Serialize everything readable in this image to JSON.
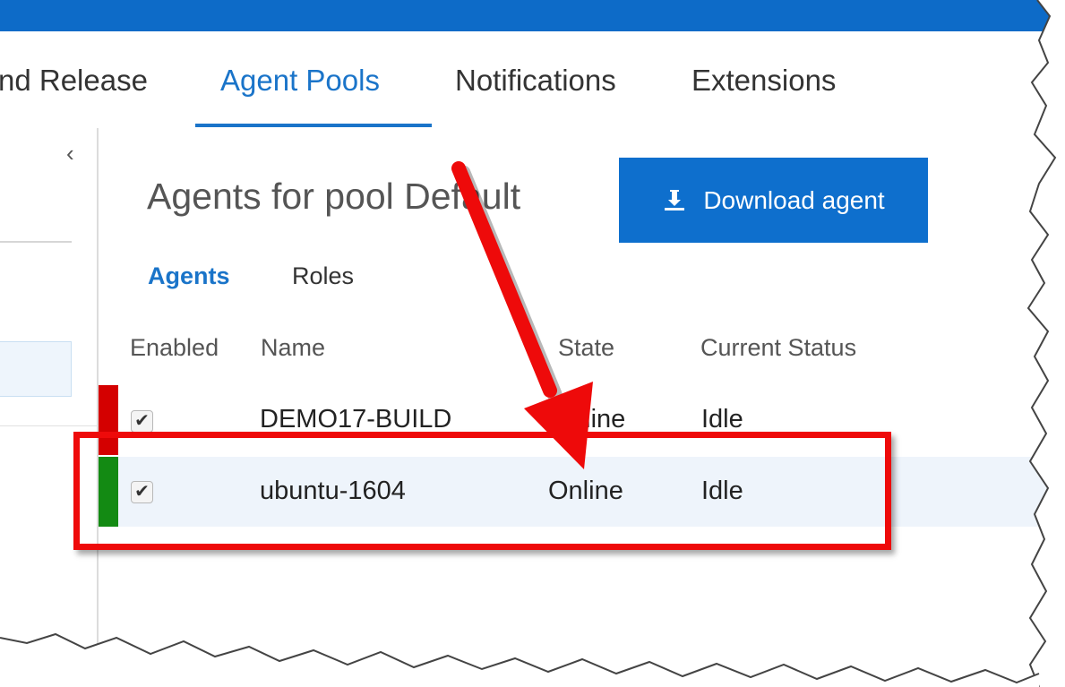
{
  "tabs": [
    {
      "label": "nd Release"
    },
    {
      "label": "Agent Pools"
    },
    {
      "label": "Notifications"
    },
    {
      "label": "Extensions"
    }
  ],
  "left_pane": {
    "collapse_glyph": "‹"
  },
  "page": {
    "title": "Agents for pool Default",
    "download_button": {
      "label": "Download agent",
      "icon": "download-icon"
    }
  },
  "subtabs": [
    {
      "label": "Agents"
    },
    {
      "label": "Roles"
    }
  ],
  "table": {
    "columns": [
      "Enabled",
      "Name",
      "State",
      "Current Status"
    ],
    "rows": [
      {
        "enabled": "✔",
        "name": "DEMO17-BUILD",
        "state": "Offline",
        "status": "Idle",
        "status_color": "#d40000"
      },
      {
        "enabled": "✔",
        "name": "ubuntu-1604",
        "state": "Online",
        "status": "Idle",
        "status_color": "#138a13"
      }
    ]
  },
  "colors": {
    "accent": "#0e6fcd",
    "annotation": "#ee0a0a",
    "offline": "#d40000",
    "online": "#138a13"
  }
}
